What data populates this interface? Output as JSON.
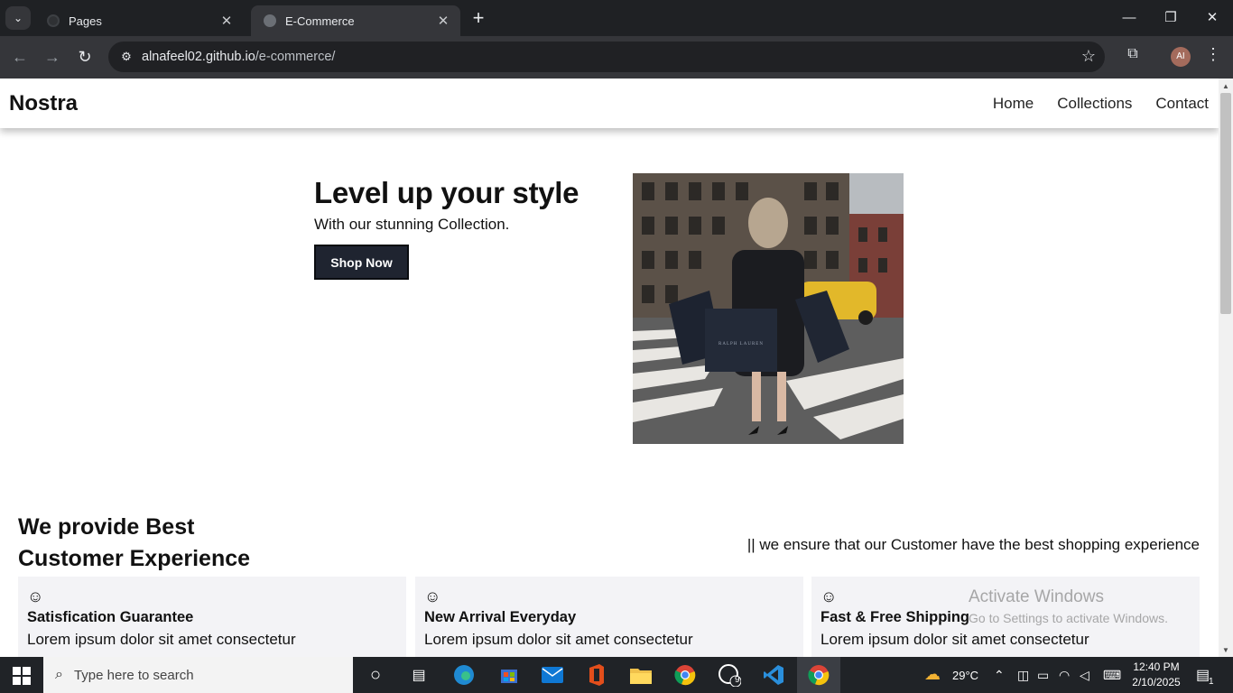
{
  "browser": {
    "tabs": [
      {
        "title": "Pages"
      },
      {
        "title": "E-Commerce"
      }
    ],
    "url_host": "alnafeel02.github.io",
    "url_path": "/e-commerce/",
    "profile_initials": "AI"
  },
  "site": {
    "logo": "Nostra",
    "nav": [
      "Home",
      "Collections",
      "Contact"
    ],
    "hero": {
      "title": "Level up your style",
      "subtitle": "With our stunning Collection.",
      "cta": "Shop Now"
    },
    "section": {
      "title": "We provide Best Customer Experience",
      "note": "|| we ensure that our Customer have the best shopping experience"
    },
    "features": [
      {
        "icon": "smiley-icon",
        "title": "Satisfication Guarantee",
        "text": "Lorem ipsum dolor sit amet consectetur"
      },
      {
        "icon": "smiley-icon",
        "title": "New Arrival Everyday",
        "text": "Lorem ipsum dolor sit amet consectetur"
      },
      {
        "icon": "smiley-icon",
        "title": "Fast & Free Shipping",
        "text": "Lorem ipsum dolor sit amet consectetur"
      }
    ]
  },
  "watermark": {
    "line1": "Activate Windows",
    "line2": "Go to Settings to activate Windows."
  },
  "taskbar": {
    "search_placeholder": "Type here to search",
    "whatsapp_badge": "9",
    "temperature": "29°C",
    "time": "12:40 PM",
    "date": "2/10/2025",
    "notification_count": "1"
  },
  "colors": {
    "button_bg": "#1f2430",
    "card_bg": "#f3f3f6",
    "chrome_dark": "#1f2124",
    "toolbar": "#35363a"
  }
}
